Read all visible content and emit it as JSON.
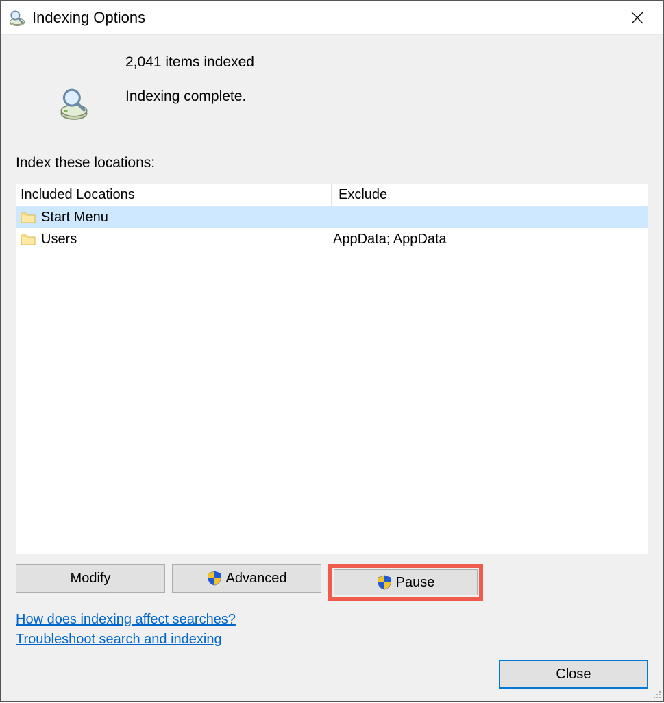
{
  "window": {
    "title": "Indexing Options"
  },
  "status": {
    "count_text": "2,041 items indexed",
    "state_text": "Indexing complete."
  },
  "section_label": "Index these locations:",
  "columns": {
    "included": "Included Locations",
    "exclude": "Exclude"
  },
  "rows": [
    {
      "name": "Start Menu",
      "exclude": "",
      "selected": true
    },
    {
      "name": "Users",
      "exclude": "AppData; AppData",
      "selected": false
    }
  ],
  "buttons": {
    "modify": "Modify",
    "advanced": "Advanced",
    "pause": "Pause",
    "close": "Close"
  },
  "links": {
    "help": "How does indexing affect searches?",
    "troubleshoot": "Troubleshoot search and indexing"
  }
}
